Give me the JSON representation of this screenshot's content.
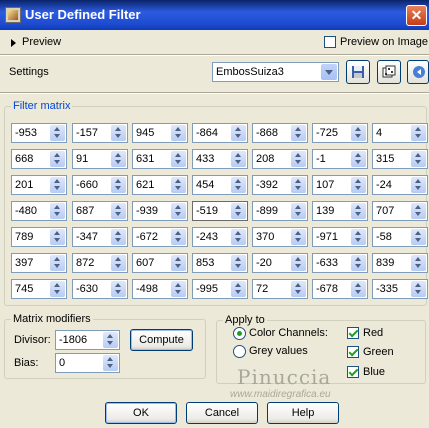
{
  "window": {
    "title": "User Defined Filter",
    "close_glyph": "✕"
  },
  "preview": {
    "label": "Preview",
    "on_image_label": "Preview on Image",
    "on_image_checked": false
  },
  "settings": {
    "label": "Settings",
    "selected": "EmbosSuiza3"
  },
  "filter_matrix": {
    "title": "Filter matrix",
    "rows": [
      [
        "-953",
        "-157",
        "945",
        "-864",
        "-868",
        "-725",
        "4"
      ],
      [
        "668",
        "91",
        "631",
        "433",
        "208",
        "-1",
        "315"
      ],
      [
        "201",
        "-660",
        "621",
        "454",
        "-392",
        "107",
        "-24"
      ],
      [
        "-480",
        "687",
        "-939",
        "-519",
        "-899",
        "139",
        "707"
      ],
      [
        "789",
        "-347",
        "-672",
        "-243",
        "370",
        "-971",
        "-58"
      ],
      [
        "397",
        "872",
        "607",
        "853",
        "-20",
        "-633",
        "839"
      ],
      [
        "745",
        "-630",
        "-498",
        "-995",
        "72",
        "-678",
        "-335"
      ]
    ]
  },
  "modifiers": {
    "title": "Matrix modifiers",
    "divisor_label": "Divisor:",
    "divisor": "-1806",
    "bias_label": "Bias:",
    "bias": "0",
    "compute_label": "Compute"
  },
  "apply_to": {
    "title": "Apply to",
    "color_channels": "Color Channels:",
    "grey_values": "Grey values",
    "mode": "color",
    "red": "Red",
    "green": "Green",
    "blue": "Blue",
    "red_checked": true,
    "green_checked": true,
    "blue_checked": true
  },
  "buttons": {
    "ok": "OK",
    "cancel": "Cancel",
    "help": "Help"
  },
  "watermark": {
    "name": "Pinuccia",
    "url": "www.maidiregrafica.eu"
  },
  "colors": {
    "titlebar": "#0a246a",
    "face": "#ece9d8",
    "group_title": "#0046d5"
  }
}
